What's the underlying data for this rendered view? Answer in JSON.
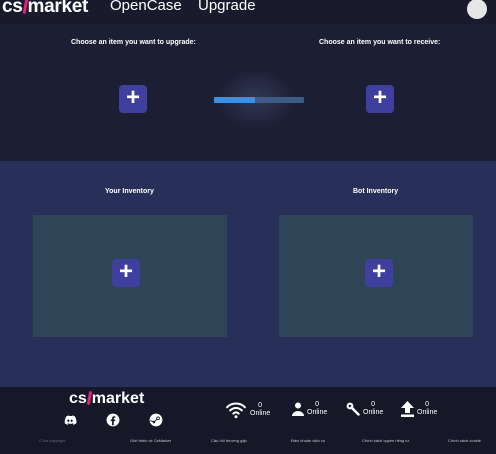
{
  "header": {
    "logo_left": "cs",
    "logo_right": "market",
    "nav": [
      {
        "label": "OpenCase"
      },
      {
        "label": "Upgrade"
      }
    ]
  },
  "upgrade": {
    "choose_upgrade_label": "Choose an item you want to upgrade:",
    "choose_receive_label": "Choose an item you want to receive:",
    "plus_symbol": "+",
    "progress_fraction": 0.45
  },
  "inventory": {
    "your_title": "Your Inventory",
    "bot_title": "Bot Inventory",
    "plus_symbol": "+"
  },
  "footer": {
    "logo_left": "cs",
    "logo_right": "market",
    "social_icons": [
      "discord-icon",
      "facebook-icon",
      "steam-icon"
    ],
    "stats": [
      {
        "icon": "wifi-icon",
        "count": "0",
        "label": "Online"
      },
      {
        "icon": "user-icon",
        "count": "0",
        "label": "Online"
      },
      {
        "icon": "wrench-icon",
        "count": "0",
        "label": "Online"
      },
      {
        "icon": "arrow-up-icon",
        "count": "0",
        "label": "Online"
      }
    ],
    "links": {
      "copyright": "© No copyright",
      "about": "Giới thiệu về CsMarket",
      "faq": "Câu hỏi thường gặp",
      "terms": "Điều khoản dịch vụ",
      "privacy": "Chính sách quyền riêng tư",
      "cookies": "Chính sách cookie"
    }
  },
  "colors": {
    "accent_pink": "#e0267a",
    "button_purple": "#3e3f9e",
    "progress_fill": "#3d8fe0",
    "progress_track": "#3f5a86"
  }
}
